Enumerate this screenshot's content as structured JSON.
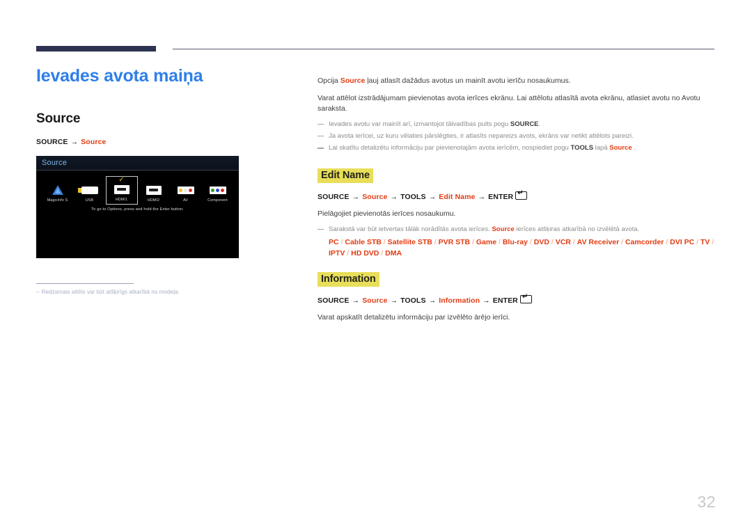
{
  "header": {
    "bar_color": "#2e3352",
    "rule_color": "#5a5a72"
  },
  "left": {
    "page_title": "Ievades avota maiņa",
    "section_title": "Source",
    "breadcrumb": {
      "start": "SOURCE",
      "arrow": "→",
      "target": "Source"
    },
    "tv": {
      "panel_title": "Source",
      "hint": "To go to Options, press and hold the Enter button.",
      "check_mark": "✓",
      "sources": [
        {
          "label": "MagicInfo S",
          "icon": "magicinfo-icon",
          "selected": false
        },
        {
          "label": "USB",
          "icon": "usb-icon",
          "selected": false
        },
        {
          "label": "HDMI1",
          "icon": "hdmi-icon",
          "selected": true
        },
        {
          "label": "HDMI2",
          "icon": "hdmi-icon",
          "selected": false
        },
        {
          "label": "AV",
          "icon": "rca-av-icon",
          "selected": false
        },
        {
          "label": "Component",
          "icon": "rca-component-icon",
          "selected": false
        }
      ],
      "av_colors": [
        "#e8c32a",
        "#e8e8e8",
        "#d62d20"
      ],
      "component_colors": [
        "#2aa02a",
        "#2a46d6",
        "#d62d20"
      ]
    },
    "footnote": {
      "dash": "–",
      "text": "Redzamais attēls var būt atšķirīgs atkarībā no modeļa."
    }
  },
  "right": {
    "intro": {
      "p1_a": "Opcija ",
      "p1_hl": "Source",
      "p1_b": " ļauj atlasīt dažādus avotus un mainīt avotu ierīču nosaukumus.",
      "p2": "Varat attēlot izstrādājumam pievienotas avota ierīces ekrānu. Lai attēlotu atlasītā avota ekrānu, atlasiet avotu no Avotu saraksta."
    },
    "notes": [
      {
        "a": "Ievades avotu var mainīt arī, izmantojot tālvadības pults pogu ",
        "bold": "SOURCE",
        "b": "."
      },
      {
        "a": "Ja avota ierīcei, uz kuru vēlaties pārslēgties, ir atlasīts nepareizs avots, ekrāns var netikt attēlots pareizi.",
        "bold": "",
        "b": ""
      },
      {
        "a": "Lai skatītu detalizētu informāciju par pievienotajām avota ierīcēm, nospiediet pogu ",
        "bold": "TOOLS",
        "b": " lapā ",
        "hl": "Source",
        "c": " ."
      }
    ],
    "edit_name": {
      "heading": "Edit Name",
      "path": {
        "p1": "SOURCE",
        "p2": "Source",
        "p3": "TOOLS",
        "p4": "Edit Name",
        "p5": "ENTER",
        "arrow": "→"
      },
      "desc": "Pielāgojiet pievienotās ierīces nosaukumu.",
      "note_a": "Sarakstā var būt ietvertas tālāk norādītās avota ierīces. ",
      "note_hl": "Source",
      "note_b": " ierīces atšķiras atkarībā no izvēlētā avota.",
      "devices": [
        "PC",
        "Cable STB",
        "Satellite STB",
        "PVR STB",
        "Game",
        "Blu-ray",
        "DVD",
        "VCR",
        "AV Receiver",
        "Camcorder",
        "DVI PC",
        "TV",
        "IPTV",
        "HD DVD",
        "DMA"
      ],
      "device_separator": "/"
    },
    "information": {
      "heading": "Information",
      "path": {
        "p1": "SOURCE",
        "p2": "Source",
        "p3": "TOOLS",
        "p4": "Information",
        "p5": "ENTER",
        "arrow": "→"
      },
      "desc": "Varat apskatīt detalizētu informāciju par izvēlēto ārējo ierīci."
    }
  },
  "page_number": "32",
  "colors": {
    "accent_red": "#e23b12",
    "title_blue": "#2e7fe8",
    "highlight_yellow": "#e8de5a",
    "navy": "#2e3352"
  }
}
